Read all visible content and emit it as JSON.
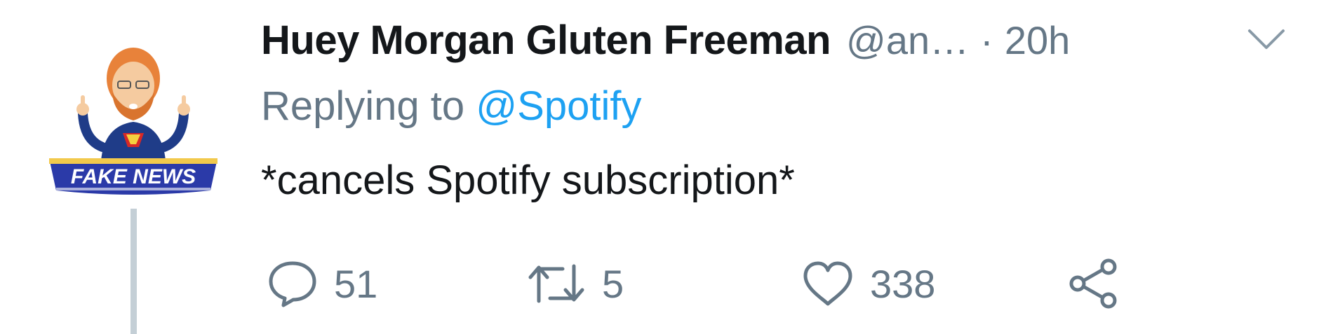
{
  "tweet": {
    "display_name": "Huey Morgan Gluten Freeman",
    "handle": "@an…",
    "separator": "·",
    "time": "20h",
    "replying_prefix": "Replying to ",
    "replying_to": "@Spotify",
    "text": "*cancels Spotify subscription*",
    "avatar_banner_text": "FAKE NEWS",
    "actions": {
      "reply_count": "51",
      "retweet_count": "5",
      "like_count": "338"
    }
  },
  "icons": {
    "reply": "reply-bubble-icon",
    "retweet": "retweet-arrows-icon",
    "like": "heart-icon",
    "share": "share-icon",
    "menu": "chevron-down-icon"
  },
  "colors": {
    "text_primary": "#14171a",
    "text_secondary": "#657786",
    "link": "#1da1f2",
    "thread_line": "#c4cfd6"
  }
}
